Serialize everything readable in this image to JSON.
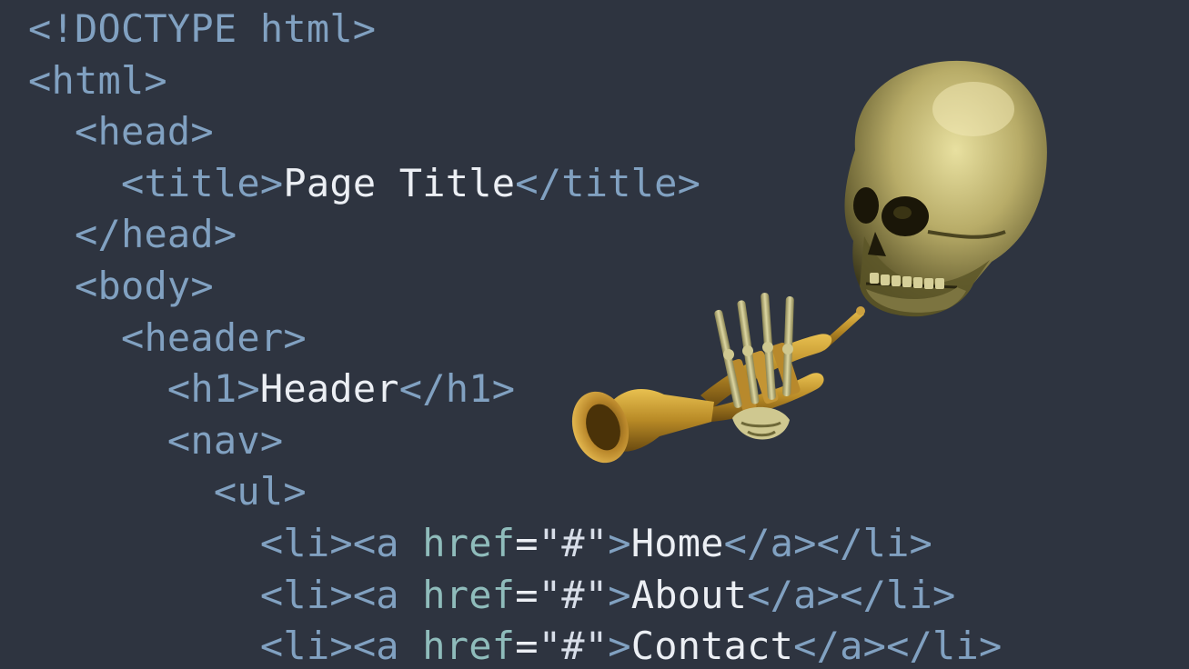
{
  "colors": {
    "background": "#2e3440",
    "tag": "#81a1c1",
    "attribute": "#8fbcbb",
    "text": "#eceff4"
  },
  "code": {
    "l1": {
      "tag": "<!DOCTYPE html>"
    },
    "l2": {
      "tag": "<html>"
    },
    "l3": {
      "tag": "<head>"
    },
    "l4": {
      "open": "<title>",
      "text": "Page Title",
      "close": "</title>"
    },
    "l5": {
      "tag": "</head>"
    },
    "l6": {
      "tag": "<body>"
    },
    "l7": {
      "tag": "<header>"
    },
    "l8": {
      "open": "<h1>",
      "text": "Header",
      "close": "</h1>"
    },
    "l9": {
      "tag": "<nav>"
    },
    "l10": {
      "tag": "<ul>"
    },
    "links": [
      {
        "open": "<li><a",
        "attr": "href",
        "eq": "=",
        "value": "\"#\"",
        "gt": ">",
        "text": "Home",
        "close": "</a></li>"
      },
      {
        "open": "<li><a",
        "attr": "href",
        "eq": "=",
        "value": "\"#\"",
        "gt": ">",
        "text": "About",
        "close": "</a></li>"
      },
      {
        "open": "<li><a",
        "attr": "href",
        "eq": "=",
        "value": "\"#\"",
        "gt": ">",
        "text": "Contact",
        "close": "</a></li>"
      }
    ]
  },
  "artwork": {
    "icon": "trumpet-skeleton-icon"
  }
}
